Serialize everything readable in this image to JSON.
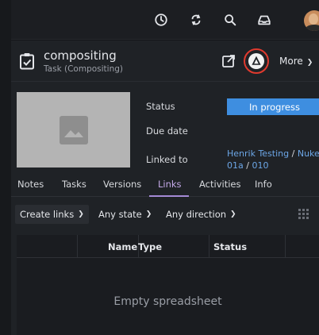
{
  "header": {
    "title": "compositing",
    "subtitle": "Task (Compositing)",
    "more_label": "More"
  },
  "fields": {
    "status_label": "Status",
    "status_value": "In progress",
    "due_label": "Due date",
    "linked_label": "Linked to",
    "linked_path": [
      {
        "text": "Henrik Testing",
        "link": true
      },
      {
        "text": " / ",
        "link": false
      },
      {
        "text": "Nuke",
        "link": true
      },
      {
        "text": "01a",
        "link": true
      },
      {
        "text": " / ",
        "link": false
      },
      {
        "text": "010",
        "link": true
      }
    ]
  },
  "tabs": [
    {
      "label": "Notes"
    },
    {
      "label": "Tasks"
    },
    {
      "label": "Versions"
    },
    {
      "label": "Links"
    },
    {
      "label": "Activities"
    },
    {
      "label": "Info"
    }
  ],
  "toolbar": {
    "create_links": "Create links",
    "any_state": "Any state",
    "any_direction": "Any direction"
  },
  "sheet": {
    "columns": [
      "Name",
      "Type",
      "Status"
    ],
    "empty_message": "Empty spreadsheet"
  },
  "colors": {
    "status_blue": "#3e8ee0",
    "tab_active": "#c4a9e8",
    "highlight_ring": "#e03a2e"
  },
  "icons": {
    "topbar": [
      "clock-icon",
      "sync-icon",
      "search-icon",
      "inbox-icon"
    ],
    "header": [
      "task-icon",
      "external-link-icon",
      "ai-assistant-icon"
    ]
  }
}
